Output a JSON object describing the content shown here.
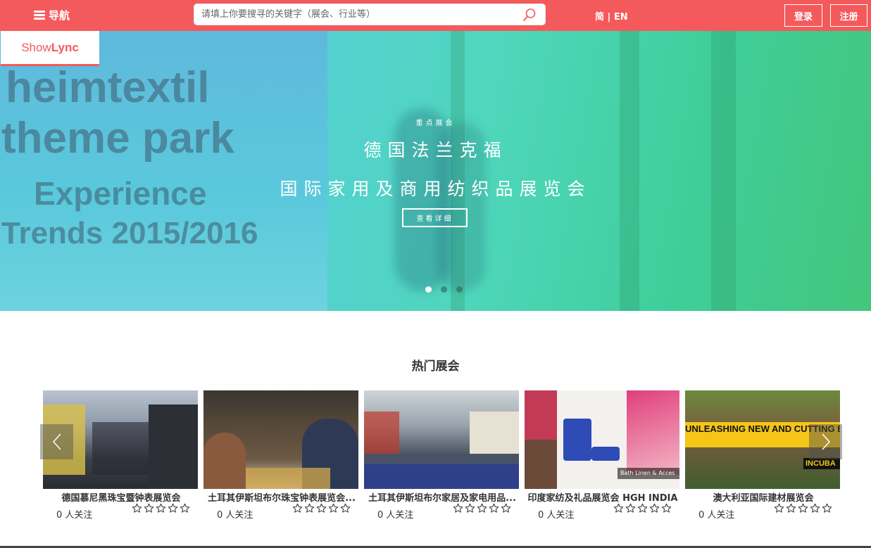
{
  "header": {
    "nav_label": "导航",
    "search_placeholder": "请填上你要搜寻的关键字（展会、行业等）",
    "lang_zh": "简",
    "lang_sep": "|",
    "lang_en": "EN",
    "login": "登录",
    "register": "注册"
  },
  "logo": {
    "part1": "Show",
    "part2": "Lync"
  },
  "hero": {
    "kicker": "重点展会",
    "title1": "德国法兰克福",
    "title2": "国际家用及商用纺织品展览会",
    "button": "查看详细",
    "bg_lines": [
      "heimtextil",
      "theme park",
      "Experience",
      "Trends 2015/2016"
    ],
    "slide_count": 3,
    "active_slide": 1
  },
  "hot": {
    "title": "热门展会",
    "cards": [
      {
        "name": "德国慕尼黑珠宝暨钟表展览会",
        "follow": "0 人关注"
      },
      {
        "name": "土耳其伊斯坦布尔珠宝钟表展览会...",
        "follow": "0 人关注"
      },
      {
        "name": "土耳其伊斯坦布尔家居及家电用品...",
        "follow": "0 人关注"
      },
      {
        "name": "印度家纺及礼品展览会 HGH INDIA",
        "follow": "0 人关注",
        "thumb_caption": "Bath Linen & Acces"
      },
      {
        "name": "澳大利亚国际建材展览会",
        "follow": "0 人关注",
        "thumb_caption": "UNLEASHING NEW AND CUTTING EDGE PRODUCTS AND IDEAS TO YOU",
        "thumb_caption2": "INCUBA"
      }
    ]
  },
  "colors": {
    "brand": "#f45a5c",
    "hero_start": "#5cc4d8",
    "hero_end": "#43c67c"
  },
  "icons": [
    "hamburger-icon",
    "search-icon",
    "chevron-left-icon",
    "chevron-right-icon",
    "star-outline-icon"
  ]
}
